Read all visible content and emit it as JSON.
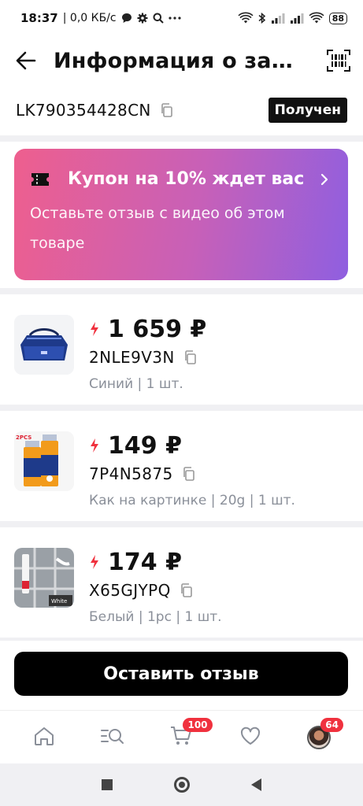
{
  "status_bar": {
    "time": "18:37",
    "net_speed": "| 0,0 КБ/с",
    "battery": "88"
  },
  "header": {
    "title": "Информация о зак..."
  },
  "order": {
    "tracking_number": "LK790354428CN",
    "status": "Получен"
  },
  "coupon": {
    "title": "Купон на 10% ждет вас",
    "subtitle": "Оставьте отзыв с видео об этом товаре"
  },
  "items": [
    {
      "price": "1 659 ₽",
      "code": "2NLE9V3N",
      "variant": "Синий | 1 шт."
    },
    {
      "price": "149 ₽",
      "code": "7P4N5875",
      "variant": "Как на картинке | 20g | 1 шт."
    },
    {
      "price": "174 ₽",
      "code": "X65GJYPQ",
      "variant": "Белый | 1pc | 1 шт."
    }
  ],
  "thumb_labels": {
    "glue_tag": "2PCS",
    "grout_tag": "White"
  },
  "review_button": "Оставить отзыв",
  "tabbar": {
    "cart_count": "100",
    "account_count": "64"
  },
  "colors": {
    "accent_red": "#f0313e",
    "coupon_start": "#ee5f8e",
    "coupon_end": "#8f5fe0"
  }
}
